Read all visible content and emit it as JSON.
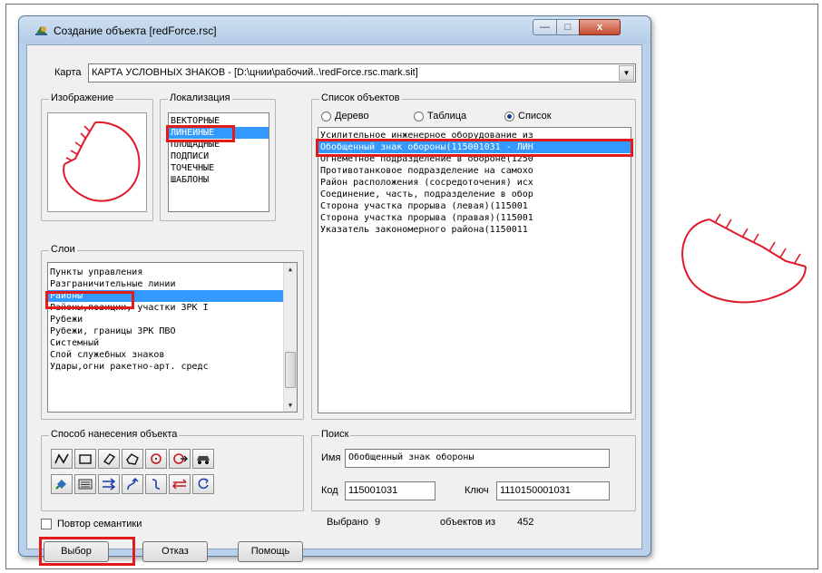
{
  "window": {
    "title": "Создание объекта  [redForce.rsc]",
    "controls": {
      "minimize": "—",
      "maximize": "□",
      "close": "x"
    }
  },
  "map": {
    "label": "Карта",
    "value": "КАРТА УСЛОВНЫХ ЗНАКОВ - [D:\\цнии\\рабочий..\\redForce.rsc.mark.sit]"
  },
  "image_group": {
    "title": "Изображение"
  },
  "localization": {
    "title": "Локализация",
    "items": [
      "ВЕКТОРНЫЕ",
      "ЛИНЕЙНЫЕ",
      "ПЛОЩАДНЫЕ",
      "ПОДПИСИ",
      "ТОЧЕЧНЫЕ",
      "ШАБЛОНЫ"
    ],
    "selected": "ЛИНЕЙНЫЕ"
  },
  "layers": {
    "title": "Слои",
    "items": [
      "Пункты управления",
      "Разграничительные линии",
      "Районы",
      "Районы,позиции, участки ЗРК I",
      "Рубежи",
      "Рубежи, границы ЗРК ПВО",
      "Системный",
      "Слой служебных знаков",
      "Удары,огни ракетно-арт. средс"
    ],
    "selected": "Районы"
  },
  "objects": {
    "title": "Список объектов",
    "view_options": [
      "Дерево",
      "Таблица",
      "Список"
    ],
    "selected_view": "Список",
    "items": [
      "Усилительное инженерное оборудование из",
      "Обобщенный знак обороны(115001031 - ЛИН",
      "Огнеметное подразделение в обороне(1250",
      "Противотанковое подразделение на самохо",
      "Район расположения (сосредоточения) исх",
      "Соединение, часть, подразделение в обор",
      "Сторона участка прорыва (левая)(115001",
      "Сторона участка прорыва (правая)(115001",
      "Указатель закономерного района(1150011"
    ],
    "selected": "Обобщенный знак обороны(115001031 - ЛИН"
  },
  "drawing_method": {
    "title": "Способ нанесения объекта",
    "tools": [
      "polyline-tool-icon",
      "rectangle-tool-icon",
      "rotated-rectangle-tool-icon",
      "polygon-tool-icon",
      "circle-tool-icon",
      "circle-arrow-tool-icon",
      "vehicle-tool-icon",
      "fill-bucket-tool-icon",
      "keyboard-tool-icon",
      "double-arrow-tool-icon",
      "curved-arrow-tool-icon",
      "curve-tool-icon",
      "swap-arrows-tool-icon",
      "rotate-tool-icon"
    ]
  },
  "search": {
    "title": "Поиск",
    "name_label": "Имя",
    "name_value": "Обобщенный знак обороны",
    "code_label": "Код",
    "code_value": "115001031",
    "key_label": "Ключ",
    "key_value": "1110150001031"
  },
  "semantics_repeat": {
    "label": "Повтор семантики",
    "checked": false
  },
  "status": {
    "selected_label": "Выбрано",
    "selected_count": "9",
    "of_label": "объектов из",
    "total": "452"
  },
  "buttons": {
    "select": "Выбор",
    "cancel": "Отказ",
    "help": "Помощь"
  },
  "colors": {
    "highlight": "#e11a1a",
    "symbol": "#e01a2a",
    "selection": "#3399ff"
  }
}
